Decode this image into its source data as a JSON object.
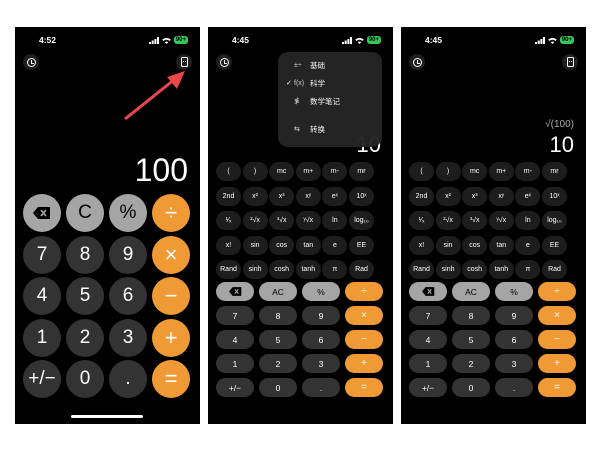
{
  "screens": [
    {
      "status": {
        "time": "4:52",
        "battery": "90+"
      },
      "display": "100",
      "keys": [
        {
          "label": "",
          "kind": "fn",
          "name": "backspace-key"
        },
        {
          "label": "C",
          "kind": "fn",
          "name": "clear-key"
        },
        {
          "label": "%",
          "kind": "fn",
          "name": "percent-key"
        },
        {
          "label": "÷",
          "kind": "op",
          "name": "divide-key"
        },
        {
          "label": "7",
          "kind": "num",
          "name": "digit-7-key"
        },
        {
          "label": "8",
          "kind": "num",
          "name": "digit-8-key"
        },
        {
          "label": "9",
          "kind": "num",
          "name": "digit-9-key"
        },
        {
          "label": "×",
          "kind": "op",
          "name": "multiply-key"
        },
        {
          "label": "4",
          "kind": "num",
          "name": "digit-4-key"
        },
        {
          "label": "5",
          "kind": "num",
          "name": "digit-5-key"
        },
        {
          "label": "6",
          "kind": "num",
          "name": "digit-6-key"
        },
        {
          "label": "−",
          "kind": "op",
          "name": "minus-key"
        },
        {
          "label": "1",
          "kind": "num",
          "name": "digit-1-key"
        },
        {
          "label": "2",
          "kind": "num",
          "name": "digit-2-key"
        },
        {
          "label": "3",
          "kind": "num",
          "name": "digit-3-key"
        },
        {
          "label": "+",
          "kind": "op",
          "name": "plus-key"
        },
        {
          "label": "+/−",
          "kind": "num",
          "name": "sign-key"
        },
        {
          "label": "0",
          "kind": "num",
          "name": "digit-0-key"
        },
        {
          "label": ".",
          "kind": "num",
          "name": "decimal-key"
        },
        {
          "label": "=",
          "kind": "op",
          "name": "equals-key"
        }
      ]
    },
    {
      "status": {
        "time": "4:45",
        "battery": "90+"
      },
      "display": "10",
      "menu": [
        {
          "icon": "±÷",
          "label": "基础",
          "checked": false
        },
        {
          "icon": "f(x)",
          "label": "科学",
          "checked": true
        },
        {
          "icon": "≸",
          "label": "数学笔记",
          "checked": false
        },
        {
          "icon": "⇆",
          "label": "转换",
          "checked": false
        }
      ]
    },
    {
      "status": {
        "time": "4:45",
        "battery": "90+"
      },
      "expression": "√(100)",
      "display": "10"
    }
  ],
  "sci_keys": [
    [
      "(",
      ")",
      "mc",
      "m+",
      "m-",
      "mr"
    ],
    [
      "2nd",
      "x²",
      "x³",
      "xʸ",
      "eˣ",
      "10ˣ"
    ],
    [
      "¹⁄ₓ",
      "²√x",
      "³√x",
      "ʸ√x",
      "ln",
      "log₁₀"
    ],
    [
      "x!",
      "sin",
      "cos",
      "tan",
      "e",
      "EE"
    ],
    [
      "Rand",
      "sinh",
      "cosh",
      "tanh",
      "π",
      "Rad"
    ]
  ],
  "sci_main_keys": [
    [
      "",
      "AC",
      "%",
      "÷"
    ],
    [
      "7",
      "8",
      "9",
      "×"
    ],
    [
      "4",
      "5",
      "6",
      "−"
    ],
    [
      "1",
      "2",
      "3",
      "+"
    ],
    [
      "+/−",
      "0",
      ".",
      "="
    ]
  ]
}
